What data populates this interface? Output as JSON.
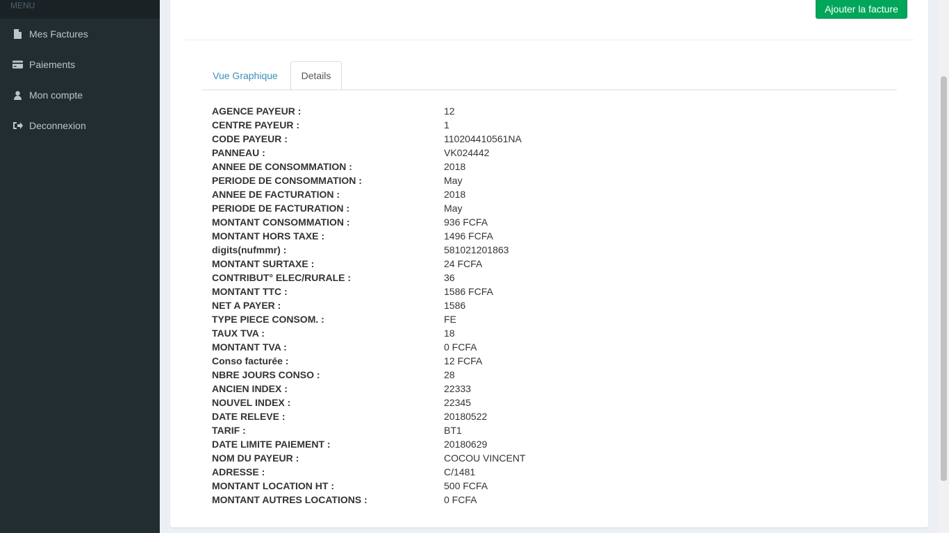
{
  "sidebar": {
    "header": "MENU",
    "items": [
      {
        "label": "Mes Factures",
        "icon": "file-icon"
      },
      {
        "label": "Paiements",
        "icon": "credit-card-icon"
      },
      {
        "label": "Mon compte",
        "icon": "user-icon"
      },
      {
        "label": "Deconnexion",
        "icon": "sign-out-icon"
      }
    ]
  },
  "toolbar": {
    "add_label": "Ajouter la facture"
  },
  "tabs": [
    {
      "label": "Vue Graphique",
      "active": false
    },
    {
      "label": "Details",
      "active": true
    }
  ],
  "details": [
    {
      "label": "AGENCE PAYEUR :",
      "value": "12"
    },
    {
      "label": "CENTRE PAYEUR :",
      "value": "1"
    },
    {
      "label": "CODE PAYEUR :",
      "value": "110204410561NA"
    },
    {
      "label": "PANNEAU :",
      "value": "VK024442"
    },
    {
      "label": "ANNEE DE CONSOMMATION :",
      "value": "2018"
    },
    {
      "label": "PERIODE DE CONSOMMATION :",
      "value": "May"
    },
    {
      "label": "ANNEE DE FACTURATION :",
      "value": "2018"
    },
    {
      "label": "PERIODE DE FACTURATION :",
      "value": "May"
    },
    {
      "label": "MONTANT CONSOMMATION :",
      "value": "936 FCFA"
    },
    {
      "label": "MONTANT HORS TAXE :",
      "value": "1496 FCFA"
    },
    {
      "label": "digits(nufmmr) :",
      "value": "581021201863"
    },
    {
      "label": "MONTANT SURTAXE :",
      "value": "24 FCFA"
    },
    {
      "label": "CONTRIBUT° ELEC/RURALE :",
      "value": "36"
    },
    {
      "label": "MONTANT TTC :",
      "value": "1586 FCFA"
    },
    {
      "label": "NET A PAYER :",
      "value": "1586"
    },
    {
      "label": "TYPE PIECE CONSOM. :",
      "value": "FE"
    },
    {
      "label": "TAUX TVA :",
      "value": "18"
    },
    {
      "label": "MONTANT TVA :",
      "value": "0 FCFA"
    },
    {
      "label": "Conso facturée :",
      "value": "12 FCFA"
    },
    {
      "label": "NBRE JOURS CONSO :",
      "value": "28"
    },
    {
      "label": "ANCIEN INDEX :",
      "value": "22333"
    },
    {
      "label": "NOUVEL INDEX :",
      "value": "22345"
    },
    {
      "label": "DATE RELEVE :",
      "value": "20180522"
    },
    {
      "label": "TARIF :",
      "value": "BT1"
    },
    {
      "label": "DATE LIMITE PAIEMENT :",
      "value": "20180629"
    },
    {
      "label": "NOM DU PAYEUR :",
      "value": "COCOU VINCENT"
    },
    {
      "label": "ADRESSE :",
      "value": "C/1481"
    },
    {
      "label": "MONTANT LOCATION HT :",
      "value": "500 FCFA"
    },
    {
      "label": "MONTANT AUTRES LOCATIONS :",
      "value": "0 FCFA"
    }
  ],
  "colors": {
    "sidebar_bg": "#222d32",
    "accent_green": "#00a65a",
    "link_blue": "#3c8dbc"
  }
}
